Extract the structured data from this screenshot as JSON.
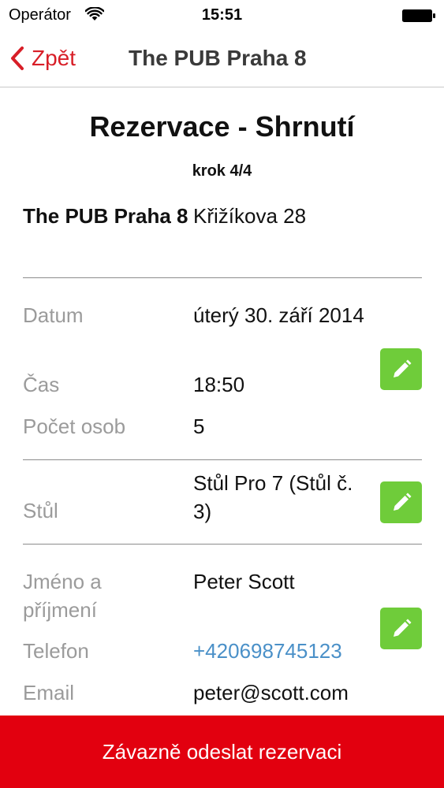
{
  "status_bar": {
    "carrier": "Operátor",
    "time": "15:51"
  },
  "nav": {
    "back_label": "Zpět",
    "title": "The PUB Praha 8"
  },
  "header": {
    "title": "Rezervace - Shrnutí",
    "step": "krok 4/4"
  },
  "venue": {
    "name": "The PUB Praha 8",
    "address": "Křižíkova 28"
  },
  "booking": {
    "date_label": "Datum",
    "date_value": "úterý 30. září 2014",
    "time_label": "Čas",
    "time_value": "18:50",
    "persons_label": "Počet osob",
    "persons_value": "5"
  },
  "table": {
    "label": "Stůl",
    "value": "Stůl Pro 7 (Stůl č. 3)"
  },
  "contact": {
    "name_label": "Jméno a příjmení",
    "name_value": "Peter Scott",
    "phone_label": "Telefon",
    "phone_value": "+420698745123",
    "email_label": "Email",
    "email_value": "peter@scott.com"
  },
  "actions": {
    "submit_label": "Závazně odeslat rezervaci"
  },
  "colors": {
    "accent_red": "#e2000f",
    "back_red": "#d81e27",
    "edit_green": "#6fcc3a",
    "link_blue": "#4a90c8"
  }
}
